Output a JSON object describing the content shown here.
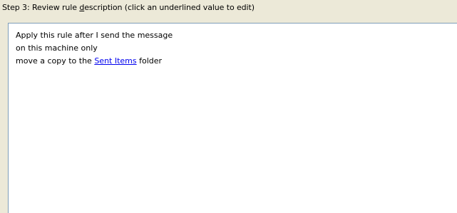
{
  "step_label": {
    "before_hotkey": "Step 3: Review rule ",
    "hotkey_char": "d",
    "after_hotkey": "escription (click an underlined value to edit)"
  },
  "rule_description": {
    "line1": "Apply this rule after I send the message",
    "line2": "on this machine only",
    "line3_prefix": "move a copy to the ",
    "line3_link": "Sent Items",
    "line3_suffix": " folder"
  }
}
